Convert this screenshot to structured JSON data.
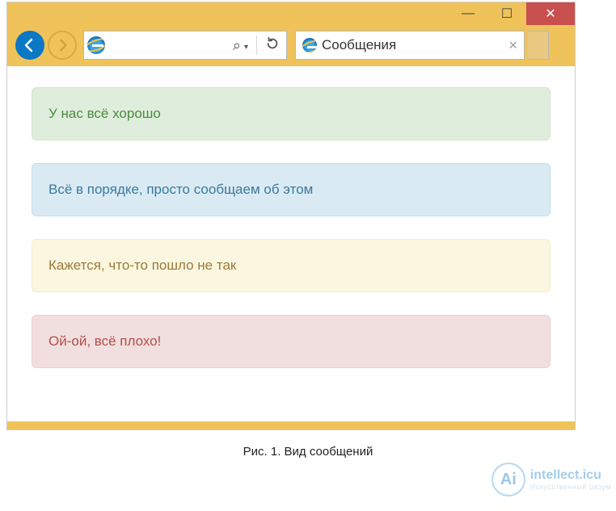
{
  "window": {
    "minimize": "—",
    "maximize": "☐",
    "close": "✕"
  },
  "nav": {
    "back": "←",
    "forward": "→",
    "search_label": "⌕",
    "dropdown": "▾",
    "refresh": "↻"
  },
  "tab": {
    "title": "Сообщения",
    "close": "×"
  },
  "messages": {
    "success": "У нас всё хорошо",
    "info": "Всё в порядке, просто сообщаем об этом",
    "warning": "Кажется, что-то пошло не так",
    "danger": "Ой-ой, всё плохо!"
  },
  "caption": "Рис. 1. Вид сообщений",
  "watermark": {
    "brand": "intellect.icu",
    "tag": "Искусственный разум",
    "logo": "Ai"
  }
}
